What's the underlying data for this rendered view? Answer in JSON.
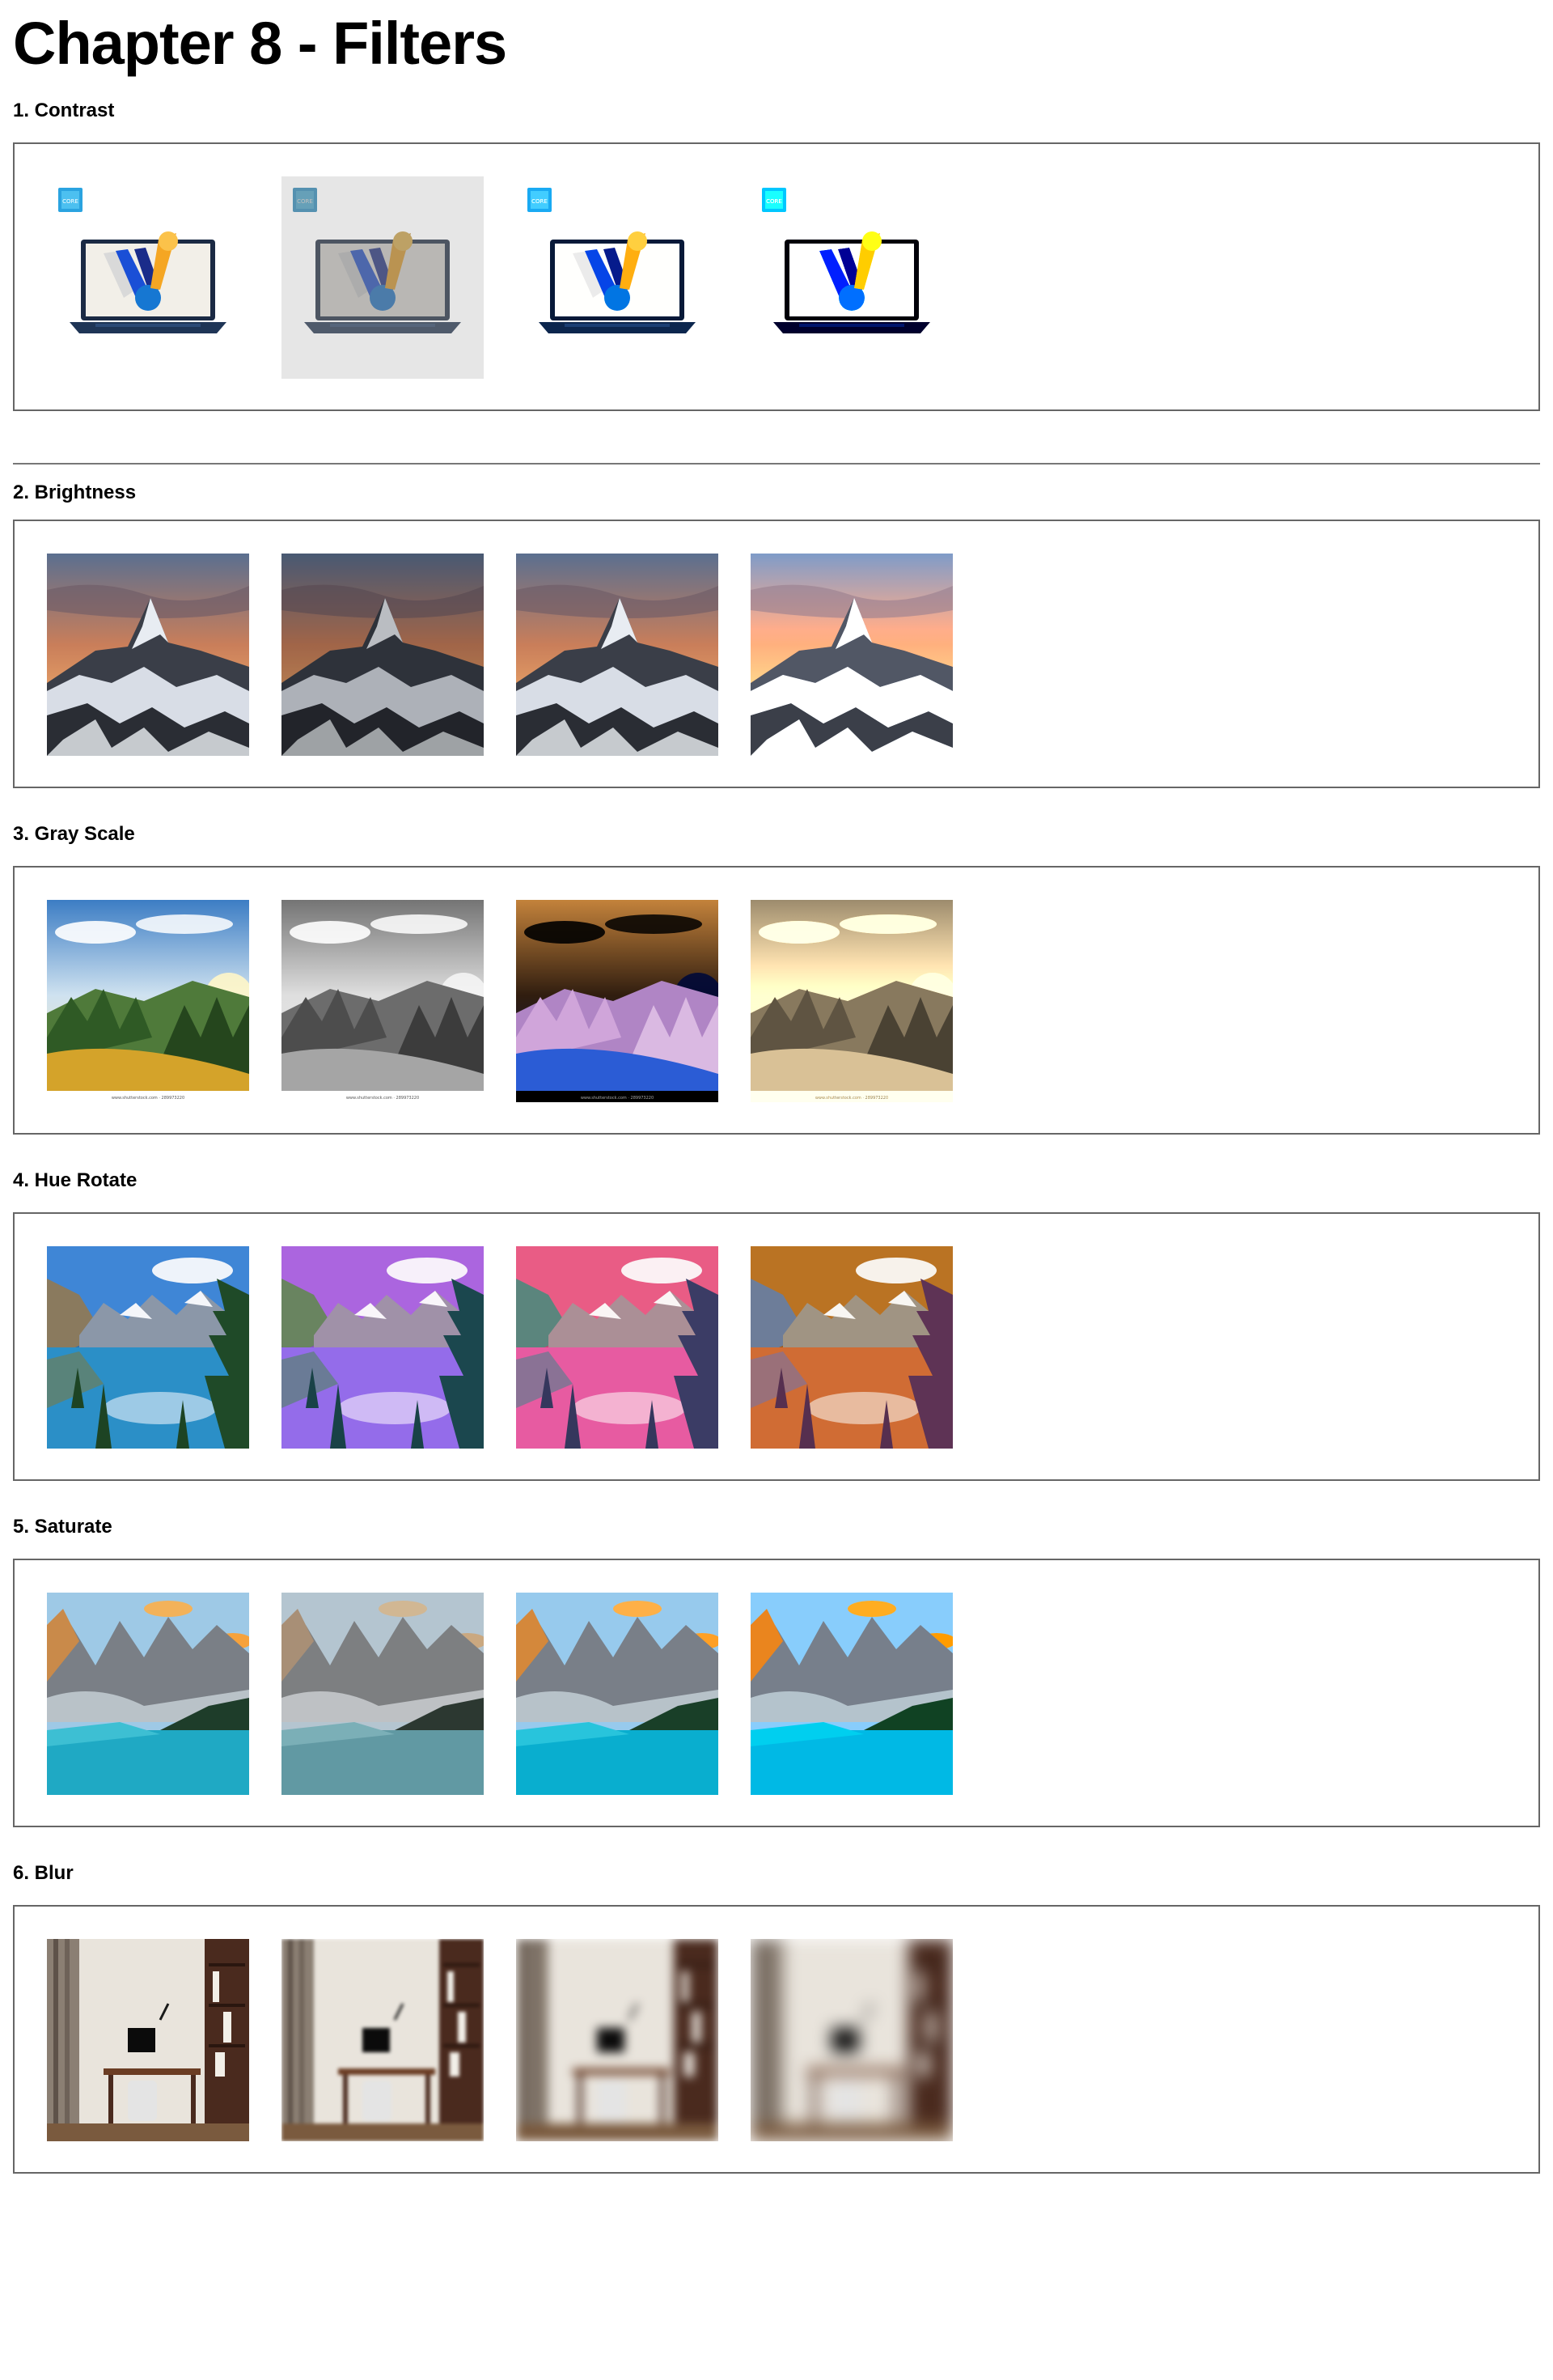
{
  "page": {
    "title": "Chapter 8 - Filters"
  },
  "sections": [
    {
      "title": "1. Contrast",
      "image": "laptop",
      "filters": [
        "contrast(1)",
        "contrast(0.5)",
        "contrast(1.2)",
        "contrast(2)"
      ]
    },
    {
      "title": "2. Brightness",
      "image": "mountain-sunset",
      "filters": [
        "brightness(1)",
        "brightness(0.8)",
        "brightness(1.0)",
        "brightness(1.4)"
      ]
    },
    {
      "title": "3. Gray Scale",
      "image": "forest-valley",
      "filters": [
        "none",
        "grayscale(1)",
        "invert(1)",
        "sepia(1)"
      ]
    },
    {
      "title": "4. Hue Rotate",
      "image": "lake-reflection",
      "filters": [
        "hue-rotate(0deg)",
        "hue-rotate(60deg)",
        "hue-rotate(120deg)",
        "hue-rotate(180deg)"
      ]
    },
    {
      "title": "5. Saturate",
      "image": "turquoise-lake",
      "filters": [
        "saturate(1)",
        "saturate(0.4)",
        "saturate(1.2)",
        "saturate(1.6)"
      ]
    },
    {
      "title": "6. Blur",
      "image": "home-office",
      "filters": [
        "blur(0px)",
        "blur(2px)",
        "blur(6px)",
        "blur(10px)"
      ]
    }
  ],
  "watermark": "www.shutterstock.com · 289973220",
  "badge": "CORE"
}
